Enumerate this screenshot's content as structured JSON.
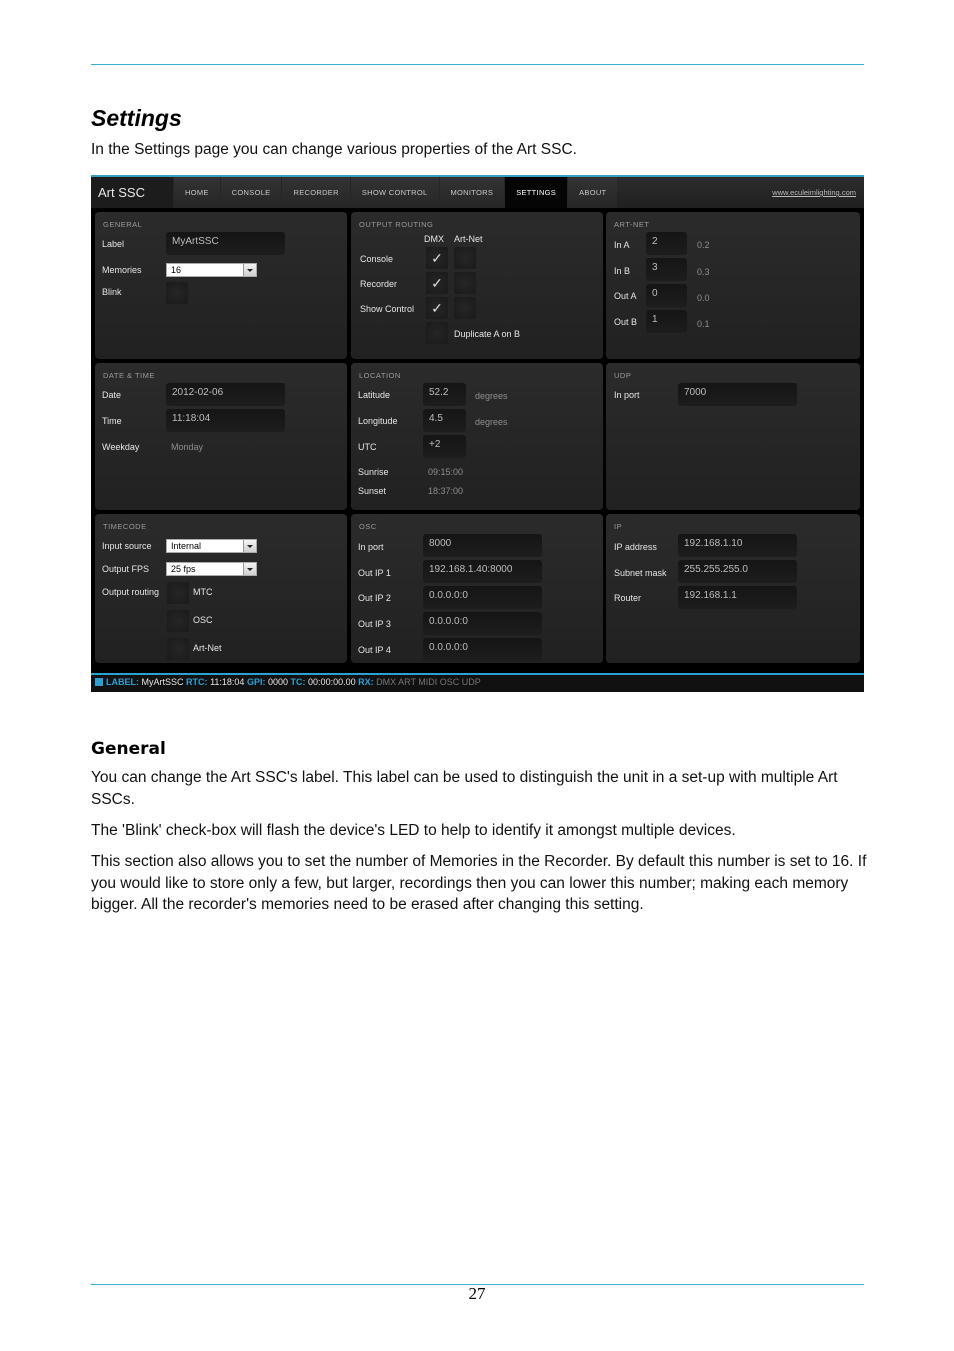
{
  "document": {
    "title": "Settings",
    "intro": "In the Settings page you can change various properties of the Art SSC.",
    "section_heading": "General",
    "paragraphs": [
      "You can change the Art SSC's label. This label can be used to distinguish the unit in a set-up with multiple Art SSCs.",
      "The 'Blink' check-box will flash the device's LED to help to identify it amongst multiple devices.",
      "This section also allows you to set the number of Memories in the Recorder. By default this number is set to 16. If you would like to store only a few, but larger, recordings then you can lower this number; making each memory bigger. All the recorder's memories need to be erased after changing this setting."
    ],
    "page_number": "27",
    "accent_color": "#3bb0cc"
  },
  "app": {
    "brand": "Art SSC",
    "nav": [
      "HOME",
      "CONSOLE",
      "RECORDER",
      "SHOW CONTROL",
      "MONITORS",
      "SETTINGS",
      "ABOUT"
    ],
    "active_nav": "SETTINGS",
    "website": "www.eculeimlighting.com",
    "general": {
      "title": "GENERAL",
      "label_label": "Label",
      "label_value": "MyArtSSC",
      "memories_label": "Memories",
      "memories_value": "16",
      "blink_label": "Blink",
      "blink_checked": false
    },
    "output_routing": {
      "title": "OUTPUT ROUTING",
      "col_dmx": "DMX",
      "col_artnet": "Art-Net",
      "rows": [
        {
          "label": "Console",
          "dmx": true,
          "artnet": false
        },
        {
          "label": "Recorder",
          "dmx": true,
          "artnet": false
        },
        {
          "label": "Show Control",
          "dmx": true,
          "artnet": false
        }
      ],
      "duplicate_label": "Duplicate A on B",
      "duplicate_checked": false
    },
    "artnet": {
      "title": "ART-NET",
      "rows": [
        {
          "label": "In A",
          "value": "2",
          "hint": "0.2"
        },
        {
          "label": "In B",
          "value": "3",
          "hint": "0.3"
        },
        {
          "label": "Out A",
          "value": "0",
          "hint": "0.0"
        },
        {
          "label": "Out B",
          "value": "1",
          "hint": "0.1"
        }
      ]
    },
    "datetime": {
      "title": "DATE & TIME",
      "date_label": "Date",
      "date_value": "2012-02-06",
      "time_label": "Time",
      "time_value": "11:18:04",
      "weekday_label": "Weekday",
      "weekday_value": "Monday"
    },
    "location": {
      "title": "LOCATION",
      "latitude_label": "Latitude",
      "latitude_value": "52.2",
      "longitude_label": "Longitude",
      "longitude_value": "4.5",
      "unit": "degrees",
      "utc_label": "UTC",
      "utc_value": "+2",
      "sunrise_label": "Sunrise",
      "sunrise_value": "09:15:00",
      "sunset_label": "Sunset",
      "sunset_value": "18:37:00"
    },
    "udp": {
      "title": "UDP",
      "inport_label": "In port",
      "inport_value": "7000"
    },
    "timecode": {
      "title": "TIMECODE",
      "input_source_label": "Input source",
      "input_source_value": "Internal",
      "output_fps_label": "Output FPS",
      "output_fps_value": "25 fps",
      "output_routing_label": "Output routing",
      "routes": [
        {
          "label": "MTC",
          "checked": false
        },
        {
          "label": "OSC",
          "checked": false
        },
        {
          "label": "Art-Net",
          "checked": false
        }
      ]
    },
    "osc": {
      "title": "OSC",
      "rows": [
        {
          "label": "In port",
          "value": "8000"
        },
        {
          "label": "Out IP 1",
          "value": "192.168.1.40:8000"
        },
        {
          "label": "Out IP 2",
          "value": "0.0.0.0:0"
        },
        {
          "label": "Out IP 3",
          "value": "0.0.0.0:0"
        },
        {
          "label": "Out IP 4",
          "value": "0.0.0.0:0"
        }
      ]
    },
    "ip": {
      "title": "IP",
      "rows": [
        {
          "label": "IP address",
          "value": "192.168.1.10"
        },
        {
          "label": "Subnet mask",
          "value": "255.255.255.0"
        },
        {
          "label": "Router",
          "value": "192.168.1.1"
        }
      ]
    },
    "status": {
      "label_key": "LABEL:",
      "label_value": "MyArtSSC",
      "rtc_key": "RTC:",
      "rtc_value": "11:18:04",
      "gpi_key": "GPI:",
      "gpi_value": "0000",
      "tc_key": "TC:",
      "tc_value": "00:00:00.00",
      "rx_key": "RX:",
      "rx_value": "DMX ART MIDI OSC UDP",
      "accent_color": "#2aa1d3"
    }
  }
}
